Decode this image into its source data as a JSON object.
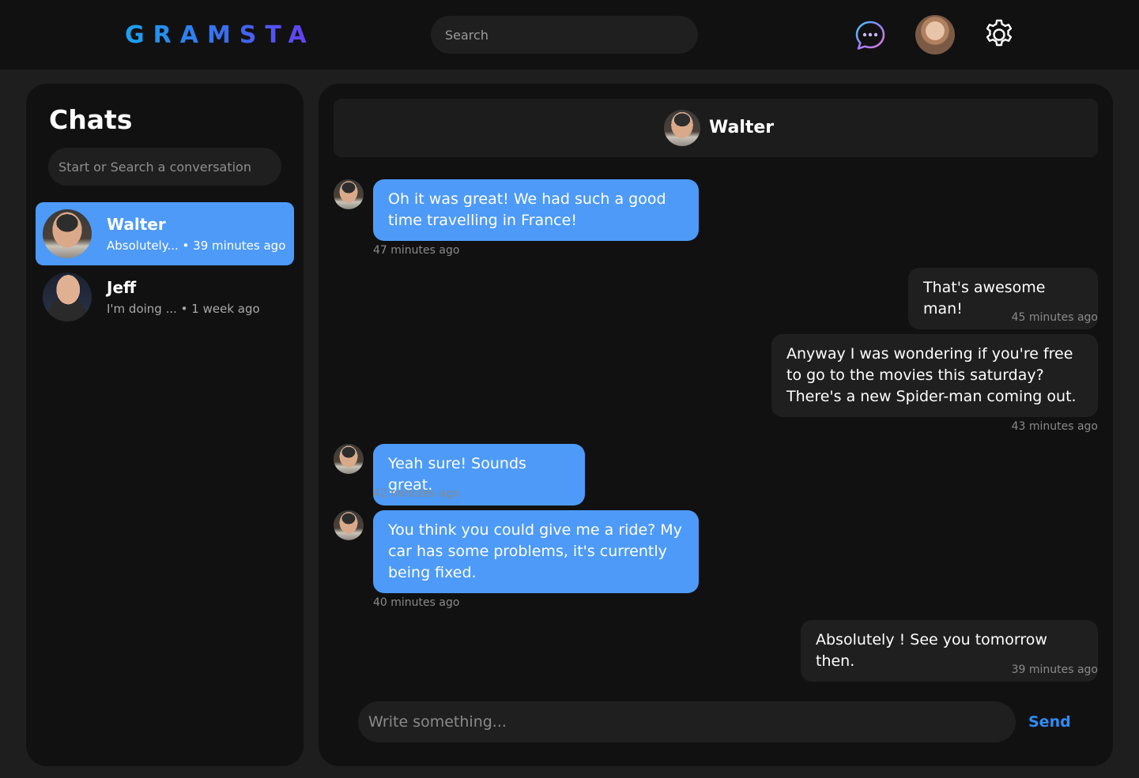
{
  "app": {
    "logo": "GRAMSTA",
    "search_placeholder": "Search",
    "icons": {
      "messages": "chat-bubble-icon",
      "profile": "user-avatar",
      "settings": "gear-icon"
    }
  },
  "sidebar": {
    "title": "Chats",
    "search_placeholder": "Start or Search a conversation",
    "items": [
      {
        "name": "Walter",
        "preview": "Absolutely... • 39 minutes ago",
        "active": true
      },
      {
        "name": "Jeff",
        "preview": "I'm doing ... • 1 week ago",
        "active": false
      }
    ]
  },
  "chat": {
    "header_name": "Walter",
    "messages": [
      {
        "from": "Walter",
        "direction": "incoming",
        "text": "Oh it was great! We had such a good time travelling in France!",
        "time": "47 minutes ago"
      },
      {
        "from": "me",
        "direction": "outgoing",
        "text": "That's awesome man!",
        "time": "45 minutes ago"
      },
      {
        "from": "me",
        "direction": "outgoing",
        "text": "Anyway I was wondering if you're free to go to the movies this saturday? There's a new Spider-man coming out.",
        "time": "43 minutes ago"
      },
      {
        "from": "Walter",
        "direction": "incoming",
        "text": "Yeah sure! Sounds great.",
        "time": "42 minutes ago"
      },
      {
        "from": "Walter",
        "direction": "incoming",
        "text": "You think you could give me a ride? My car has some problems, it's currently being fixed.",
        "time": "40 minutes ago"
      },
      {
        "from": "me",
        "direction": "outgoing",
        "text": "Absolutely ! See you tomorrow then.",
        "time": "39 minutes ago"
      }
    ],
    "compose_placeholder": "Write something...",
    "send_label": "Send"
  },
  "colors": {
    "background": "#1e1e1e",
    "panel": "#111111",
    "accent_blue": "#4d9af8",
    "send_blue": "#2f8cf6",
    "outgoing_bubble": "#1f1f1f"
  }
}
